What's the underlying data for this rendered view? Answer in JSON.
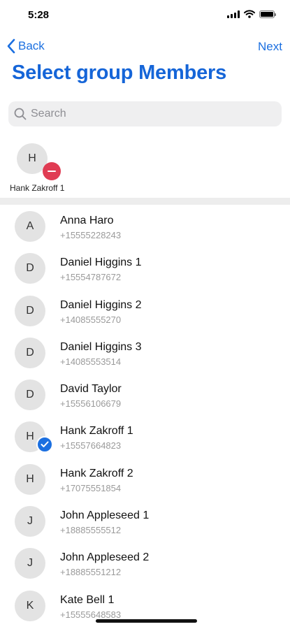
{
  "status_bar": {
    "time": "5:28"
  },
  "nav": {
    "back_label": "Back",
    "next_label": "Next"
  },
  "title": "Select group Members",
  "search": {
    "placeholder": "Search",
    "value": ""
  },
  "selected": [
    {
      "initial": "H",
      "name": "Hank Zakroff 1"
    }
  ],
  "contacts": [
    {
      "initial": "A",
      "name": "Anna Haro",
      "phone": "+15555228243",
      "selected": false
    },
    {
      "initial": "D",
      "name": "Daniel Higgins 1",
      "phone": "+15554787672",
      "selected": false
    },
    {
      "initial": "D",
      "name": "Daniel Higgins 2",
      "phone": "+14085555270",
      "selected": false
    },
    {
      "initial": "D",
      "name": "Daniel Higgins 3",
      "phone": "+14085553514",
      "selected": false
    },
    {
      "initial": "D",
      "name": "David Taylor",
      "phone": "+15556106679",
      "selected": false
    },
    {
      "initial": "H",
      "name": "Hank Zakroff 1",
      "phone": "+15557664823",
      "selected": true
    },
    {
      "initial": "H",
      "name": "Hank Zakroff 2",
      "phone": "+17075551854",
      "selected": false
    },
    {
      "initial": "J",
      "name": "John Appleseed 1",
      "phone": "+18885555512",
      "selected": false
    },
    {
      "initial": "J",
      "name": "John Appleseed 2",
      "phone": "+18885551212",
      "selected": false
    },
    {
      "initial": "K",
      "name": "Kate Bell 1",
      "phone": "+15555648583",
      "selected": false
    }
  ],
  "colors": {
    "accent": "#1b6fe0",
    "title": "#1565d8",
    "remove": "#e03c53",
    "avatar_bg": "#e3e3e3"
  }
}
